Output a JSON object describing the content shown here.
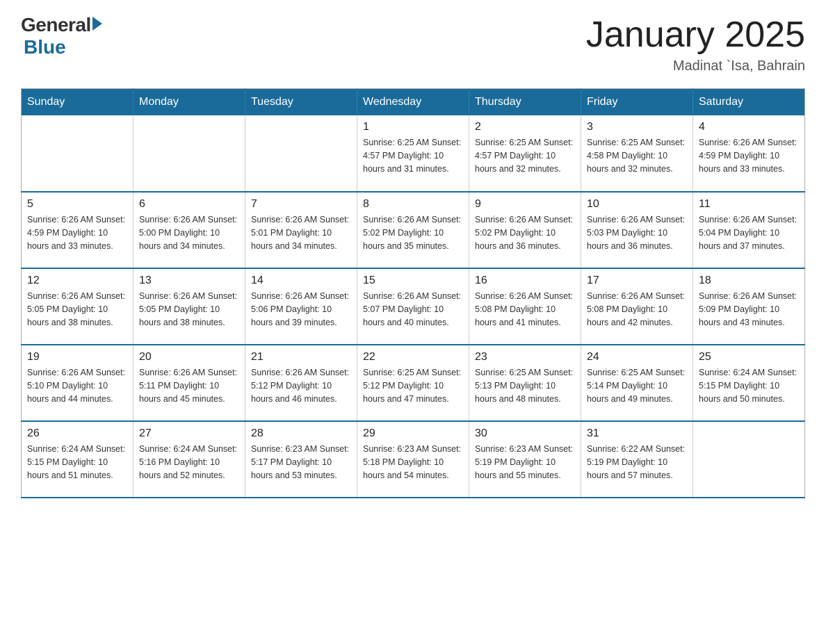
{
  "logo": {
    "general": "General",
    "blue": "Blue"
  },
  "title": "January 2025",
  "subtitle": "Madinat `Isa, Bahrain",
  "days_header": [
    "Sunday",
    "Monday",
    "Tuesday",
    "Wednesday",
    "Thursday",
    "Friday",
    "Saturday"
  ],
  "weeks": [
    [
      {
        "day": "",
        "info": ""
      },
      {
        "day": "",
        "info": ""
      },
      {
        "day": "",
        "info": ""
      },
      {
        "day": "1",
        "info": "Sunrise: 6:25 AM\nSunset: 4:57 PM\nDaylight: 10 hours\nand 31 minutes."
      },
      {
        "day": "2",
        "info": "Sunrise: 6:25 AM\nSunset: 4:57 PM\nDaylight: 10 hours\nand 32 minutes."
      },
      {
        "day": "3",
        "info": "Sunrise: 6:25 AM\nSunset: 4:58 PM\nDaylight: 10 hours\nand 32 minutes."
      },
      {
        "day": "4",
        "info": "Sunrise: 6:26 AM\nSunset: 4:59 PM\nDaylight: 10 hours\nand 33 minutes."
      }
    ],
    [
      {
        "day": "5",
        "info": "Sunrise: 6:26 AM\nSunset: 4:59 PM\nDaylight: 10 hours\nand 33 minutes."
      },
      {
        "day": "6",
        "info": "Sunrise: 6:26 AM\nSunset: 5:00 PM\nDaylight: 10 hours\nand 34 minutes."
      },
      {
        "day": "7",
        "info": "Sunrise: 6:26 AM\nSunset: 5:01 PM\nDaylight: 10 hours\nand 34 minutes."
      },
      {
        "day": "8",
        "info": "Sunrise: 6:26 AM\nSunset: 5:02 PM\nDaylight: 10 hours\nand 35 minutes."
      },
      {
        "day": "9",
        "info": "Sunrise: 6:26 AM\nSunset: 5:02 PM\nDaylight: 10 hours\nand 36 minutes."
      },
      {
        "day": "10",
        "info": "Sunrise: 6:26 AM\nSunset: 5:03 PM\nDaylight: 10 hours\nand 36 minutes."
      },
      {
        "day": "11",
        "info": "Sunrise: 6:26 AM\nSunset: 5:04 PM\nDaylight: 10 hours\nand 37 minutes."
      }
    ],
    [
      {
        "day": "12",
        "info": "Sunrise: 6:26 AM\nSunset: 5:05 PM\nDaylight: 10 hours\nand 38 minutes."
      },
      {
        "day": "13",
        "info": "Sunrise: 6:26 AM\nSunset: 5:05 PM\nDaylight: 10 hours\nand 38 minutes."
      },
      {
        "day": "14",
        "info": "Sunrise: 6:26 AM\nSunset: 5:06 PM\nDaylight: 10 hours\nand 39 minutes."
      },
      {
        "day": "15",
        "info": "Sunrise: 6:26 AM\nSunset: 5:07 PM\nDaylight: 10 hours\nand 40 minutes."
      },
      {
        "day": "16",
        "info": "Sunrise: 6:26 AM\nSunset: 5:08 PM\nDaylight: 10 hours\nand 41 minutes."
      },
      {
        "day": "17",
        "info": "Sunrise: 6:26 AM\nSunset: 5:08 PM\nDaylight: 10 hours\nand 42 minutes."
      },
      {
        "day": "18",
        "info": "Sunrise: 6:26 AM\nSunset: 5:09 PM\nDaylight: 10 hours\nand 43 minutes."
      }
    ],
    [
      {
        "day": "19",
        "info": "Sunrise: 6:26 AM\nSunset: 5:10 PM\nDaylight: 10 hours\nand 44 minutes."
      },
      {
        "day": "20",
        "info": "Sunrise: 6:26 AM\nSunset: 5:11 PM\nDaylight: 10 hours\nand 45 minutes."
      },
      {
        "day": "21",
        "info": "Sunrise: 6:26 AM\nSunset: 5:12 PM\nDaylight: 10 hours\nand 46 minutes."
      },
      {
        "day": "22",
        "info": "Sunrise: 6:25 AM\nSunset: 5:12 PM\nDaylight: 10 hours\nand 47 minutes."
      },
      {
        "day": "23",
        "info": "Sunrise: 6:25 AM\nSunset: 5:13 PM\nDaylight: 10 hours\nand 48 minutes."
      },
      {
        "day": "24",
        "info": "Sunrise: 6:25 AM\nSunset: 5:14 PM\nDaylight: 10 hours\nand 49 minutes."
      },
      {
        "day": "25",
        "info": "Sunrise: 6:24 AM\nSunset: 5:15 PM\nDaylight: 10 hours\nand 50 minutes."
      }
    ],
    [
      {
        "day": "26",
        "info": "Sunrise: 6:24 AM\nSunset: 5:15 PM\nDaylight: 10 hours\nand 51 minutes."
      },
      {
        "day": "27",
        "info": "Sunrise: 6:24 AM\nSunset: 5:16 PM\nDaylight: 10 hours\nand 52 minutes."
      },
      {
        "day": "28",
        "info": "Sunrise: 6:23 AM\nSunset: 5:17 PM\nDaylight: 10 hours\nand 53 minutes."
      },
      {
        "day": "29",
        "info": "Sunrise: 6:23 AM\nSunset: 5:18 PM\nDaylight: 10 hours\nand 54 minutes."
      },
      {
        "day": "30",
        "info": "Sunrise: 6:23 AM\nSunset: 5:19 PM\nDaylight: 10 hours\nand 55 minutes."
      },
      {
        "day": "31",
        "info": "Sunrise: 6:22 AM\nSunset: 5:19 PM\nDaylight: 10 hours\nand 57 minutes."
      },
      {
        "day": "",
        "info": ""
      }
    ]
  ]
}
